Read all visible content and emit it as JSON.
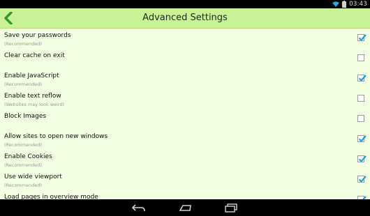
{
  "status": {
    "time": "03:43",
    "icons": [
      "wifi-icon",
      "battery-icon"
    ]
  },
  "actionbar": {
    "title": "Advanced Settings",
    "back_icon": "back-arrow-icon",
    "color": "#c9f195"
  },
  "settings": [
    {
      "label": "Save your passwords",
      "sub": "(Recommended)",
      "checked": true
    },
    {
      "label": "Clear cache on exit",
      "sub": "",
      "checked": false
    },
    {
      "label": "Enable JavaScript",
      "sub": "(Recommended)",
      "checked": true
    },
    {
      "label": "Enable text reflow",
      "sub": "(Websites may look weird)",
      "checked": false
    },
    {
      "label": "Block Images",
      "sub": "",
      "checked": false
    },
    {
      "label": "Allow sites to open new windows",
      "sub": "(Recommended)",
      "checked": true
    },
    {
      "label": "Enable Cookies",
      "sub": "(Recommended)",
      "checked": true
    },
    {
      "label": "Use wide viewport",
      "sub": "(Recommended)",
      "checked": true
    },
    {
      "label": "Load pages in overview mode",
      "sub": "",
      "checked": true
    }
  ],
  "navbar": {
    "icons": [
      "back-nav-icon",
      "home-nav-icon",
      "recents-nav-icon"
    ]
  },
  "colors": {
    "background": "#f2ffe2",
    "check": "#1aa3e0"
  }
}
